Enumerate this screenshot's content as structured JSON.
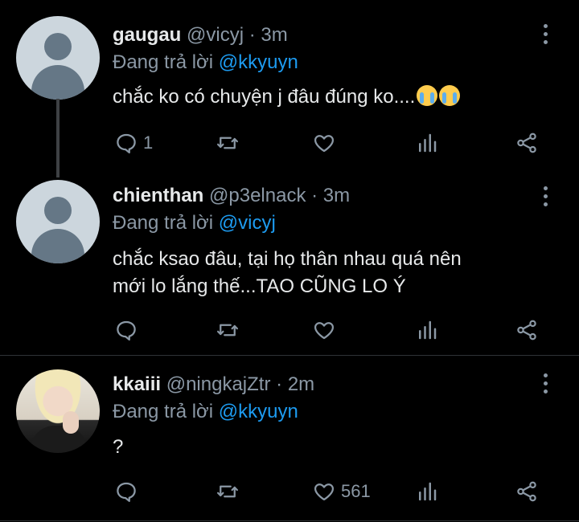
{
  "tweets": [
    {
      "name": "gaugau",
      "handle": "@vicyj",
      "dot": "·",
      "time": "3m",
      "reply_prefix": "Đang trả lời",
      "reply_to": "@kkyuyn",
      "text": "chắc ko có chuyện j đâu đúng ko....",
      "emoji": "loudly-crying-face ×2",
      "reply_count": "1",
      "like_count": ""
    },
    {
      "name": "chienthan",
      "handle": "@p3elnack",
      "dot": "·",
      "time": "3m",
      "reply_prefix": "Đang trả lời",
      "reply_to": "@vicyj",
      "text_line1": "chắc ksao đâu, tại họ thân nhau quá nên",
      "text_line2": "mới lo lắng thế...TAO CŨNG LO Ý",
      "reply_count": "",
      "like_count": ""
    },
    {
      "name": "kkaiii",
      "handle": "@ningkajZtr",
      "dot": "·",
      "time": "2m",
      "reply_prefix": "Đang trả lời",
      "reply_to": "@kkyuyn",
      "text": "?",
      "reply_count": "",
      "like_count": "561"
    }
  ],
  "colors": {
    "background": "#000000",
    "text": "#e7e9ea",
    "secondary": "#8b98a5",
    "mention": "#1d9bf0",
    "divider": "#2f3336"
  }
}
